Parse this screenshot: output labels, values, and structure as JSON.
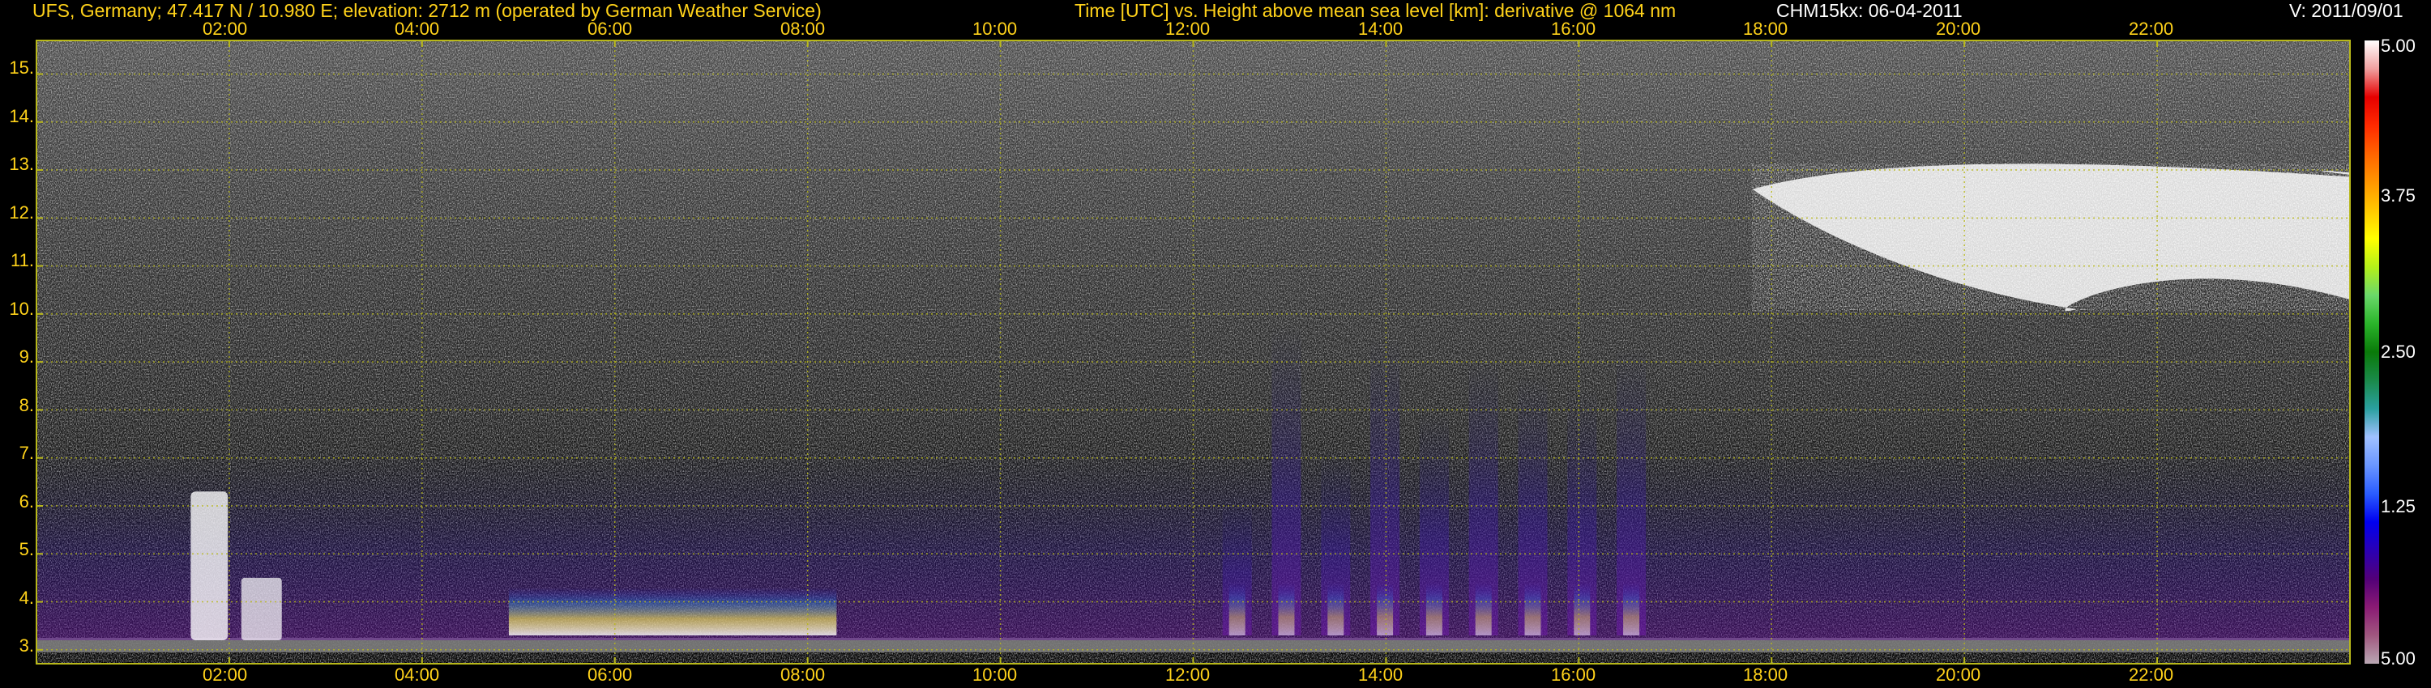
{
  "header": {
    "site": "UFS, Germany; 47.417 N / 10.980 E; elevation: 2712 m  (operated by German Weather Service)",
    "axes_desc": "Time [UTC] vs. Height above mean sea level [km]: derivative @ 1064 nm",
    "instrument": "CHM15kx: 06-04-2011",
    "version": "V: 2011/09/01"
  },
  "colors": {
    "label": "#ffd21a",
    "grid": "#b8b81a",
    "background": "#000000"
  },
  "chart_data": {
    "type": "heatmap",
    "title": "Time [UTC] vs. Height above mean sea level [km]: derivative @ 1064 nm",
    "xlabel": "Time [UTC]",
    "ylabel": "Height above mean sea level [km]",
    "xlim": [
      0,
      24
    ],
    "ylim": [
      2.71,
      15.7
    ],
    "x_ticks": [
      2,
      4,
      6,
      8,
      10,
      12,
      14,
      16,
      18,
      20,
      22
    ],
    "x_tick_labels": [
      "02:00",
      "04:00",
      "06:00",
      "08:00",
      "10:00",
      "12:00",
      "14:00",
      "16:00",
      "18:00",
      "20:00",
      "22:00"
    ],
    "y_ticks": [
      3,
      4,
      5,
      6,
      7,
      8,
      9,
      10,
      11,
      12,
      13,
      14,
      15
    ],
    "y_tick_labels": [
      "3.",
      "4.",
      "5.",
      "6.",
      "7.",
      "8.",
      "9.",
      "10.",
      "11.",
      "12.",
      "13.",
      "14.",
      "15."
    ],
    "grid": true,
    "colorbar": {
      "tick_values": [
        5.0,
        3.75,
        2.5,
        1.25,
        5.0
      ],
      "tick_labels": [
        "5.00",
        "3.75",
        "2.50",
        "1.25",
        "5.00"
      ],
      "colors": [
        "#b9a7b3",
        "#a0577f",
        "#8a1a74",
        "#520078",
        "#2a00b4",
        "#0000f0",
        "#2a5cff",
        "#6a96ff",
        "#a0c0ff",
        "#2aa0a0",
        "#1a8a4a",
        "#0a7a0a",
        "#2ab42a",
        "#6ad86a",
        "#b4f01a",
        "#ffff00",
        "#ffc800",
        "#ff9600",
        "#ff6400",
        "#ff2a00",
        "#e60000",
        "#f0a0a0",
        "#ffffff"
      ]
    },
    "features": [
      {
        "name": "surface return band",
        "t_start": 0,
        "t_end": 24,
        "h_km": [
          2.95,
          3.25
        ]
      },
      {
        "name": "boundary layer aerosol",
        "t_start": 4.9,
        "t_end": 8.3,
        "h_km": [
          3.3,
          4.3
        ]
      },
      {
        "name": "convective plumes",
        "t_start": 12.2,
        "t_end": 16.8,
        "h_km": [
          3.3,
          9.8
        ]
      },
      {
        "name": "cirrus cloud layer",
        "t_start": 17.8,
        "t_end": 24,
        "h_km": [
          9.8,
          13.1
        ]
      },
      {
        "name": "low cloud",
        "t_start": 1.6,
        "t_end": 2.3,
        "h_km": [
          3.2,
          6.3
        ]
      }
    ]
  }
}
